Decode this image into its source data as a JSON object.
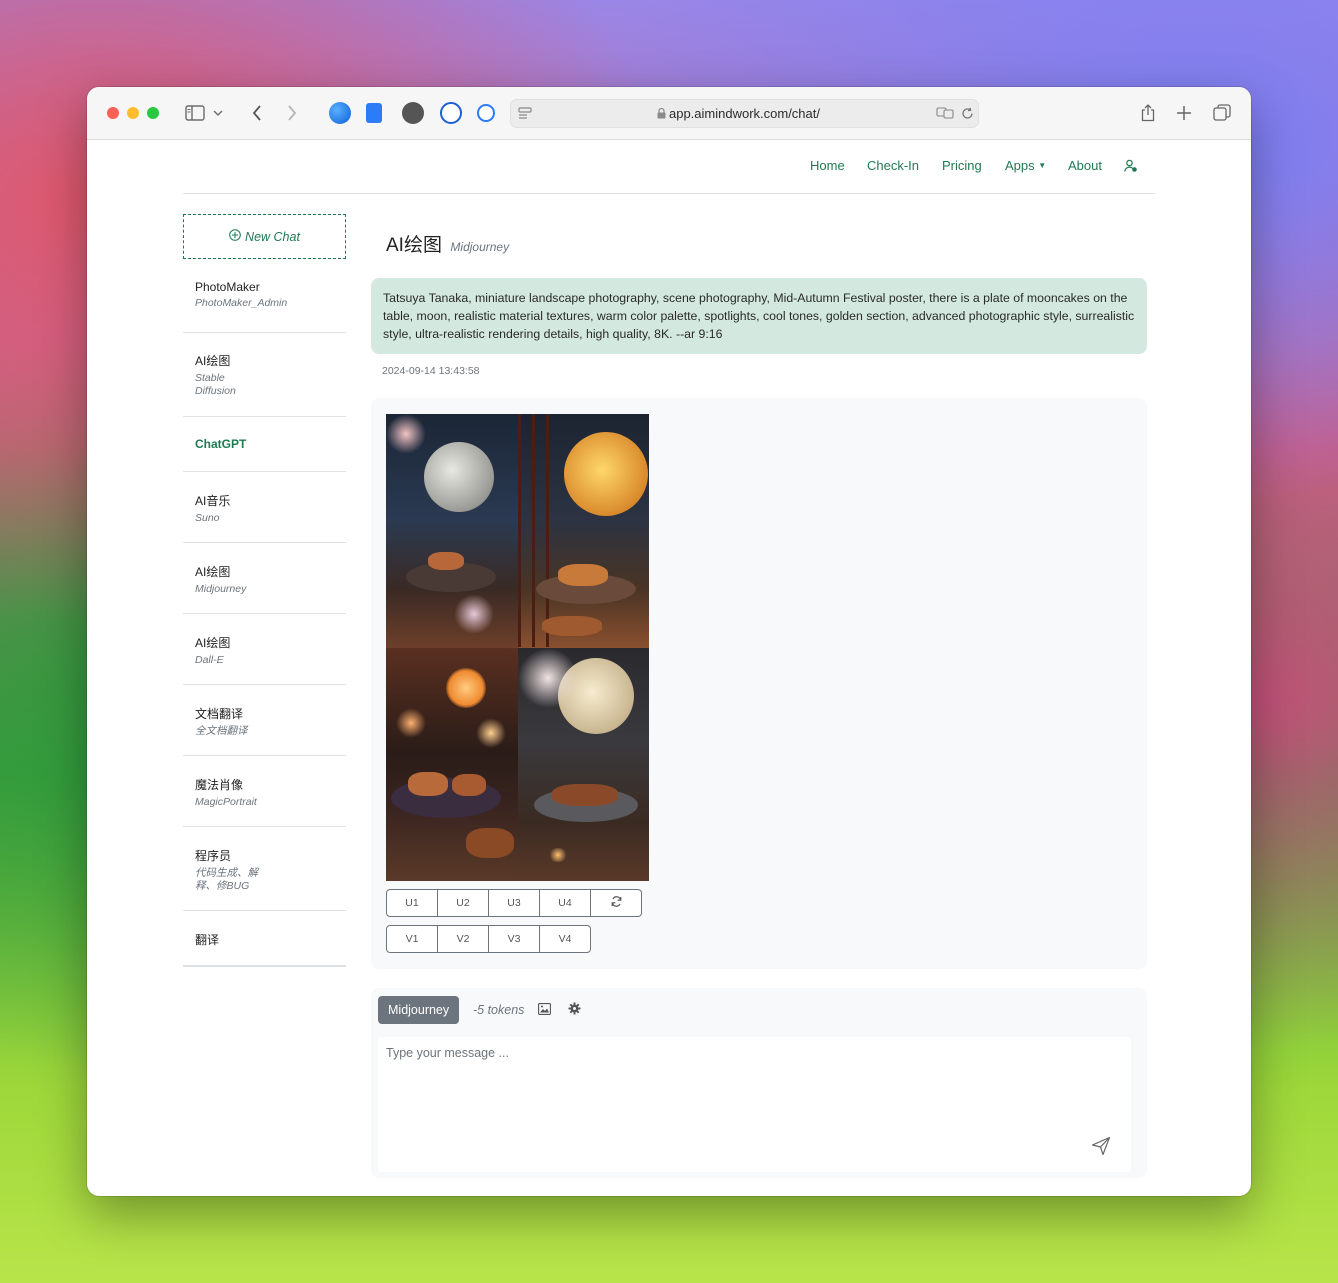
{
  "browser": {
    "url": "app.aimindwork.com/chat/"
  },
  "nav": {
    "home": "Home",
    "checkin": "Check-In",
    "pricing": "Pricing",
    "apps": "Apps",
    "about": "About"
  },
  "sidebar": {
    "new_chat": "New Chat",
    "items": [
      {
        "title": "PhotoMaker",
        "subtitle": "PhotoMaker_Admin"
      },
      {
        "title": "AI绘图",
        "subtitle": "Stable Diffusion"
      },
      {
        "title": "ChatGPT",
        "subtitle": ""
      },
      {
        "title": "AI音乐",
        "subtitle": "Suno"
      },
      {
        "title": "AI绘图",
        "subtitle": "Midjourney"
      },
      {
        "title": "AI绘图",
        "subtitle": "Dall-E"
      },
      {
        "title": "文档翻译",
        "subtitle": "全文档翻译"
      },
      {
        "title": "魔法肖像",
        "subtitle": "MagicPortrait"
      },
      {
        "title": "程序员",
        "subtitle": "代码生成、解释、修BUG"
      },
      {
        "title": "翻译",
        "subtitle": ""
      }
    ],
    "active_color": "#1f7a52"
  },
  "chat": {
    "title": "AI绘图",
    "subtitle": "Midjourney",
    "user_message": "Tatsuya Tanaka, miniature landscape photography, scene photography, Mid-Autumn Festival poster, there is a plate of mooncakes on the table, moon, realistic material textures, warm color palette, spotlights, cool tones, golden section, advanced photographic style, surrealistic style, ultra-realistic rendering details, high quality, 8K. --ar 9:16",
    "timestamp": "2024-09-14 13:43:58",
    "upscale_buttons": [
      "U1",
      "U2",
      "U3",
      "U4"
    ],
    "variation_buttons": [
      "V1",
      "V2",
      "V3",
      "V4"
    ]
  },
  "composer": {
    "model": "Midjourney",
    "tokens": "-5 tokens",
    "placeholder": "Type your message ..."
  }
}
